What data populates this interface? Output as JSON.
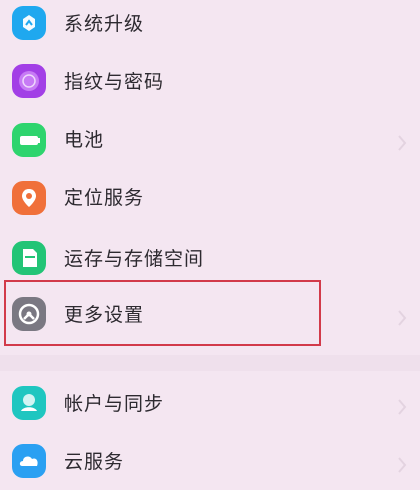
{
  "settings_items": [
    {
      "label": "系统升级",
      "icon": "system-update-icon",
      "color": "#1fa8ef"
    },
    {
      "label": "指纹与密码",
      "icon": "fingerprint-icon",
      "color": "#a23fe6"
    },
    {
      "label": "电池",
      "icon": "battery-icon",
      "color": "#2ed46e"
    },
    {
      "label": "定位服务",
      "icon": "location-icon",
      "color": "#f0703a"
    },
    {
      "label": "运存与存储空间",
      "icon": "storage-icon",
      "color": "#22c476"
    },
    {
      "label": "更多设置",
      "icon": "more-settings-icon",
      "color": "#7a7882"
    },
    {
      "label": "帐户与同步",
      "icon": "account-sync-icon",
      "color": "#1fc6c0"
    },
    {
      "label": "云服务",
      "icon": "cloud-service-icon",
      "color": "#2aa0f2"
    }
  ],
  "highlight_color": "#d23a4a"
}
